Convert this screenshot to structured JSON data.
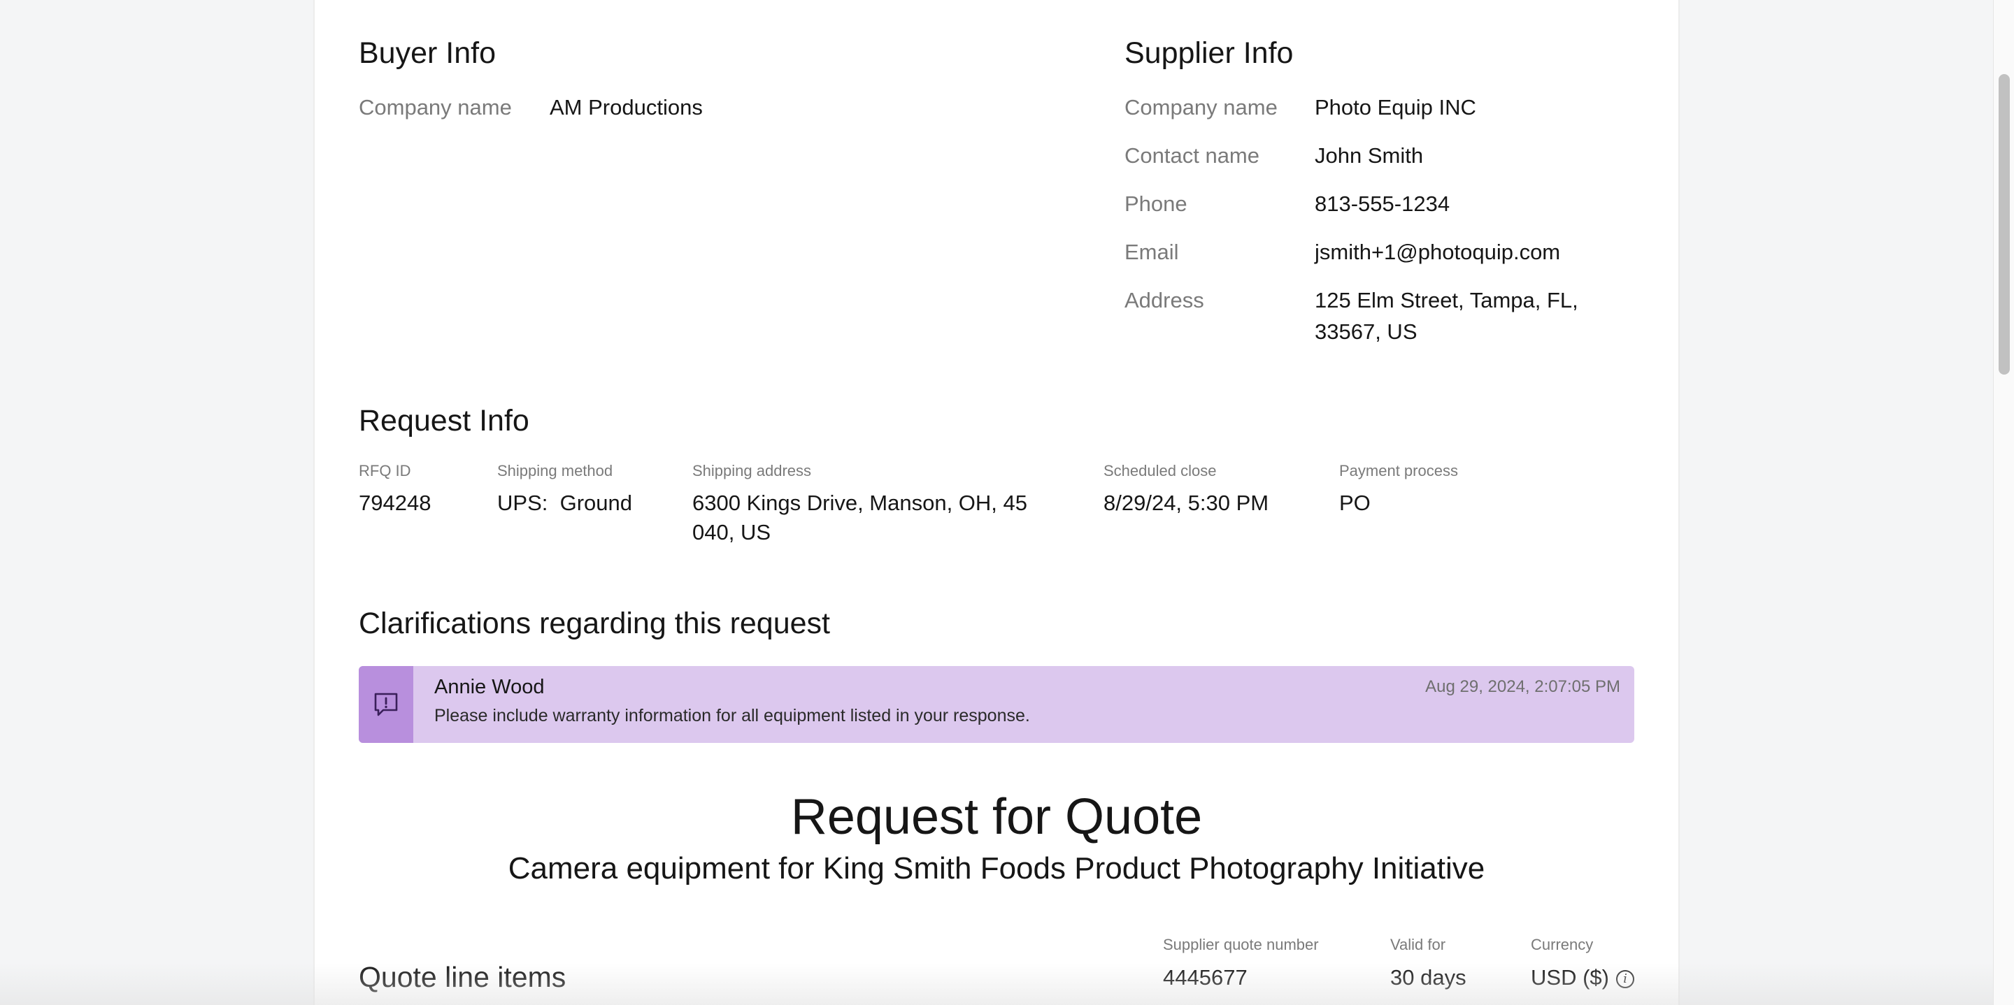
{
  "buyer": {
    "heading": "Buyer Info",
    "company_label": "Company name",
    "company_value": "AM Productions"
  },
  "supplier": {
    "heading": "Supplier Info",
    "fields": [
      {
        "label": "Company name",
        "value": "Photo Equip INC"
      },
      {
        "label": "Contact name",
        "value": "John Smith"
      },
      {
        "label": "Phone",
        "value": "813-555-1234"
      },
      {
        "label": "Email",
        "value": "jsmith+1@photoquip.com"
      },
      {
        "label": "Address",
        "value_line1": "125 Elm Street, Tampa, FL,",
        "value_line2": "33567, US"
      }
    ]
  },
  "request": {
    "heading": "Request Info",
    "columns": [
      {
        "label": "RFQ ID",
        "value": "794248"
      },
      {
        "label": "Shipping method",
        "value": "UPS:  Ground"
      },
      {
        "label": "Shipping address",
        "value_line1": "6300 Kings Drive, Manson, OH, 45",
        "value_line2": "040, US"
      },
      {
        "label": "Scheduled close",
        "value": "8/29/24, 5:30 PM"
      },
      {
        "label": "Payment process",
        "value": "PO"
      }
    ]
  },
  "clarifications": {
    "heading": "Clarifications regarding this request",
    "item": {
      "author": "Annie Wood",
      "message": "Please include warranty information for all equipment listed in your response.",
      "timestamp": "Aug 29, 2024, 2:07:05 PM",
      "icon": "message-alert-icon",
      "accent": "#b88fdd",
      "background": "#dcc8ee"
    }
  },
  "rfq": {
    "title": "Request for Quote",
    "subtitle": "Camera equipment for King Smith Foods Product Photography Initiative"
  },
  "quote": {
    "heading": "Quote line items",
    "supplier_quote_label": "Supplier quote number",
    "supplier_quote_value": "4445677",
    "valid_label": "Valid for",
    "valid_value": "30 days",
    "currency_label": "Currency",
    "currency_value": "USD ($)",
    "info_glyph": "i"
  }
}
